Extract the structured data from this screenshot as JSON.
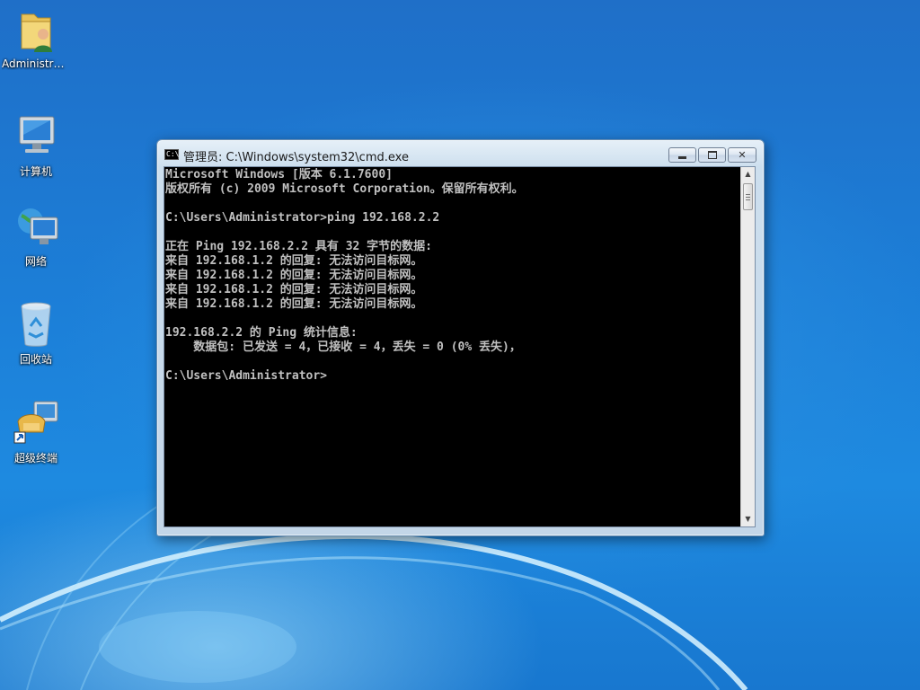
{
  "desktop": {
    "icons": [
      {
        "label": "Administra...",
        "icon": "user-folder-icon"
      },
      {
        "label": "计算机",
        "icon": "computer-icon"
      },
      {
        "label": "网络",
        "icon": "network-icon"
      },
      {
        "label": "回收站",
        "icon": "recycle-bin-icon"
      },
      {
        "label": "超级终端",
        "icon": "hyperterminal-shortcut-icon"
      }
    ]
  },
  "window": {
    "title": "管理员: C:\\Windows\\system32\\cmd.exe",
    "icon_text": "C:\\",
    "buttons": {
      "minimize": "minimize-icon",
      "maximize": "maximize-icon",
      "close": "✕"
    },
    "console_lines": [
      "Microsoft Windows [版本 6.1.7600]",
      "版权所有 (c) 2009 Microsoft Corporation。保留所有权利。",
      "",
      "C:\\Users\\Administrator>ping 192.168.2.2",
      "",
      "正在 Ping 192.168.2.2 具有 32 字节的数据:",
      "来自 192.168.1.2 的回复: 无法访问目标网。",
      "来自 192.168.1.2 的回复: 无法访问目标网。",
      "来自 192.168.1.2 的回复: 无法访问目标网。",
      "来自 192.168.1.2 的回复: 无法访问目标网。",
      "",
      "192.168.2.2 的 Ping 统计信息:",
      "    数据包: 已发送 = 4，已接收 = 4，丢失 = 0 (0% 丢失)，",
      "",
      "C:\\Users\\Administrator>"
    ],
    "scrollbar": {
      "up": "▲",
      "down": "▼"
    }
  },
  "colors": {
    "console_bg": "#000000",
    "console_fg": "#c0c0c0",
    "desktop": "#1e7fd6"
  }
}
